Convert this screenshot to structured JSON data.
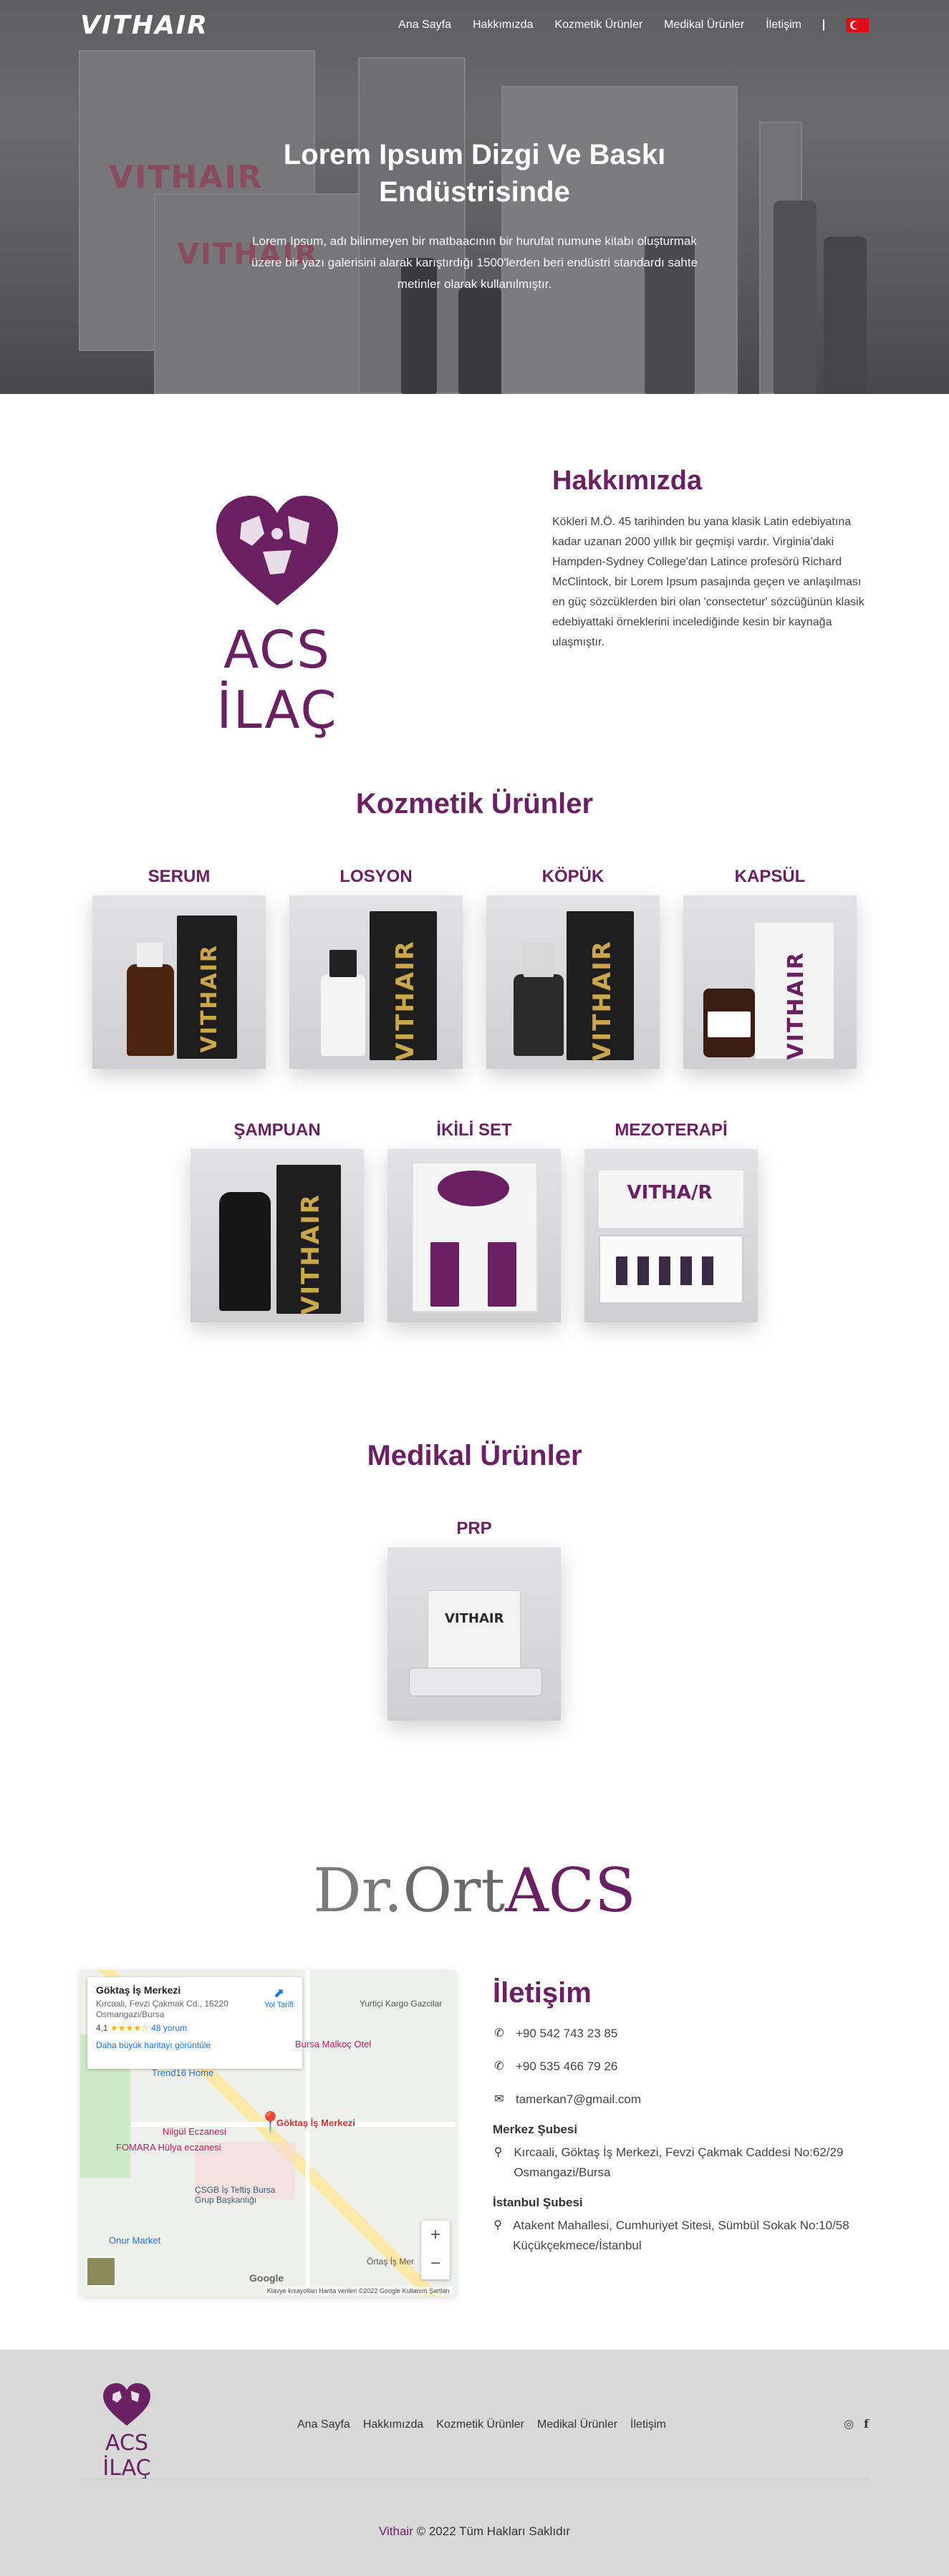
{
  "nav": {
    "logo": "VITHAIR",
    "items": [
      "Ana Sayfa",
      "Hakkımızda",
      "Kozmetik Ürünler",
      "Medikal Ürünler",
      "İletişim"
    ],
    "language_flag": "tr-flag-icon"
  },
  "hero": {
    "title": "Lorem Ipsum Dizgi Ve Baskı Endüstrisinde",
    "text": "Lorem Ipsum, adı bilinmeyen bir matbaacının bir hurufat numune kitabı oluşturmak üzere bir yazı galerisini alarak karıştırdığı 1500'lerden beri endüstri standardı sahte metinler olarak kullanılmıştır."
  },
  "about": {
    "brand": "ACS İLAÇ",
    "title": "Hakkımızda",
    "text": "Kökleri M.Ö. 45 tarihinden bu yana klasik Latin edebiyatına kadar uzanan 2000 yıllık bir geçmişi vardır. Virginia'daki Hampden-Sydney College'dan Latince profesörü Richard McClintock, bir Lorem Ipsum pasajında geçen ve anlaşılması en güç sözcüklerden biri olan 'consectetur' sözcüğünün klasik edebiyattaki örneklerini incelediğinde kesin bir kaynağa ulaşmıştır."
  },
  "cosmetic": {
    "title": "Kozmetik Ürünler",
    "products": [
      "SERUM",
      "LOSYON",
      "KÖPÜK",
      "KAPSÜL",
      "ŞAMPUAN",
      "İKİLİ SET",
      "MEZOTERAPİ"
    ]
  },
  "medical": {
    "title": "Medikal Ürünler",
    "products": [
      "PRP"
    ]
  },
  "partner": {
    "left": "Dr.",
    "mid": "Ort",
    "right": "ACS"
  },
  "map": {
    "place_name": "Göktaş İş Merkezi",
    "place_address": "Kırcaali, Fevzi Çakmak Cd., 16220 Osmangazi/Bursa",
    "rating": "4,1",
    "reviews": "48 yorum",
    "larger_map": "Daha büyük haritayı görüntüle",
    "directions": "Yol Tarifi",
    "pins": [
      "Göktaş İş Merkezi",
      "Nilgül Eczanesi",
      "FOMARA Hülya eczanesi",
      "Bursa Malkoç Otel",
      "ÇSGB İş Teftiş Bursa Grup Başkanlığı",
      "Onur Market",
      "Trend16 Home",
      "Yurtiçi Kargo Gazcilar",
      "Örtaş İş Mer"
    ],
    "attribution": "Klavye kısayolları   Harita verileri ©2022 Google   Kullanım Şartları",
    "google": "Google"
  },
  "contact": {
    "title": "İletişim",
    "phone1": "+90 542 743 23 85",
    "phone2": "+90 535 466 79 26",
    "email": "tamerkan7@gmail.com",
    "branch1_title": "Merkez Şubesi",
    "branch1_address": "Kırcaali, Göktaş İş Merkezi, Fevzi Çakmak Caddesi No:62/29 Osmangazi/Bursa",
    "branch2_title": "İstanbul Şubesi",
    "branch2_address": "Atakent Mahallesi, Cumhuriyet Sitesi, Sümbül Sokak No:10/58 Küçükçekmece/İstanbul"
  },
  "footer": {
    "brand": "ACS İLAÇ",
    "menu": [
      "Ana Sayfa",
      "Hakkımızda",
      "Kozmetik Ürünler",
      "Medikal Ürünler",
      "İletişim"
    ],
    "social": [
      "instagram-icon",
      "facebook-icon"
    ],
    "copy_brand": "Vithair",
    "copy_text": " © 2022 Tüm Hakları Saklıdır"
  },
  "colors": {
    "brand": "#6a2163",
    "footer_bg": "#d8d8d8"
  }
}
